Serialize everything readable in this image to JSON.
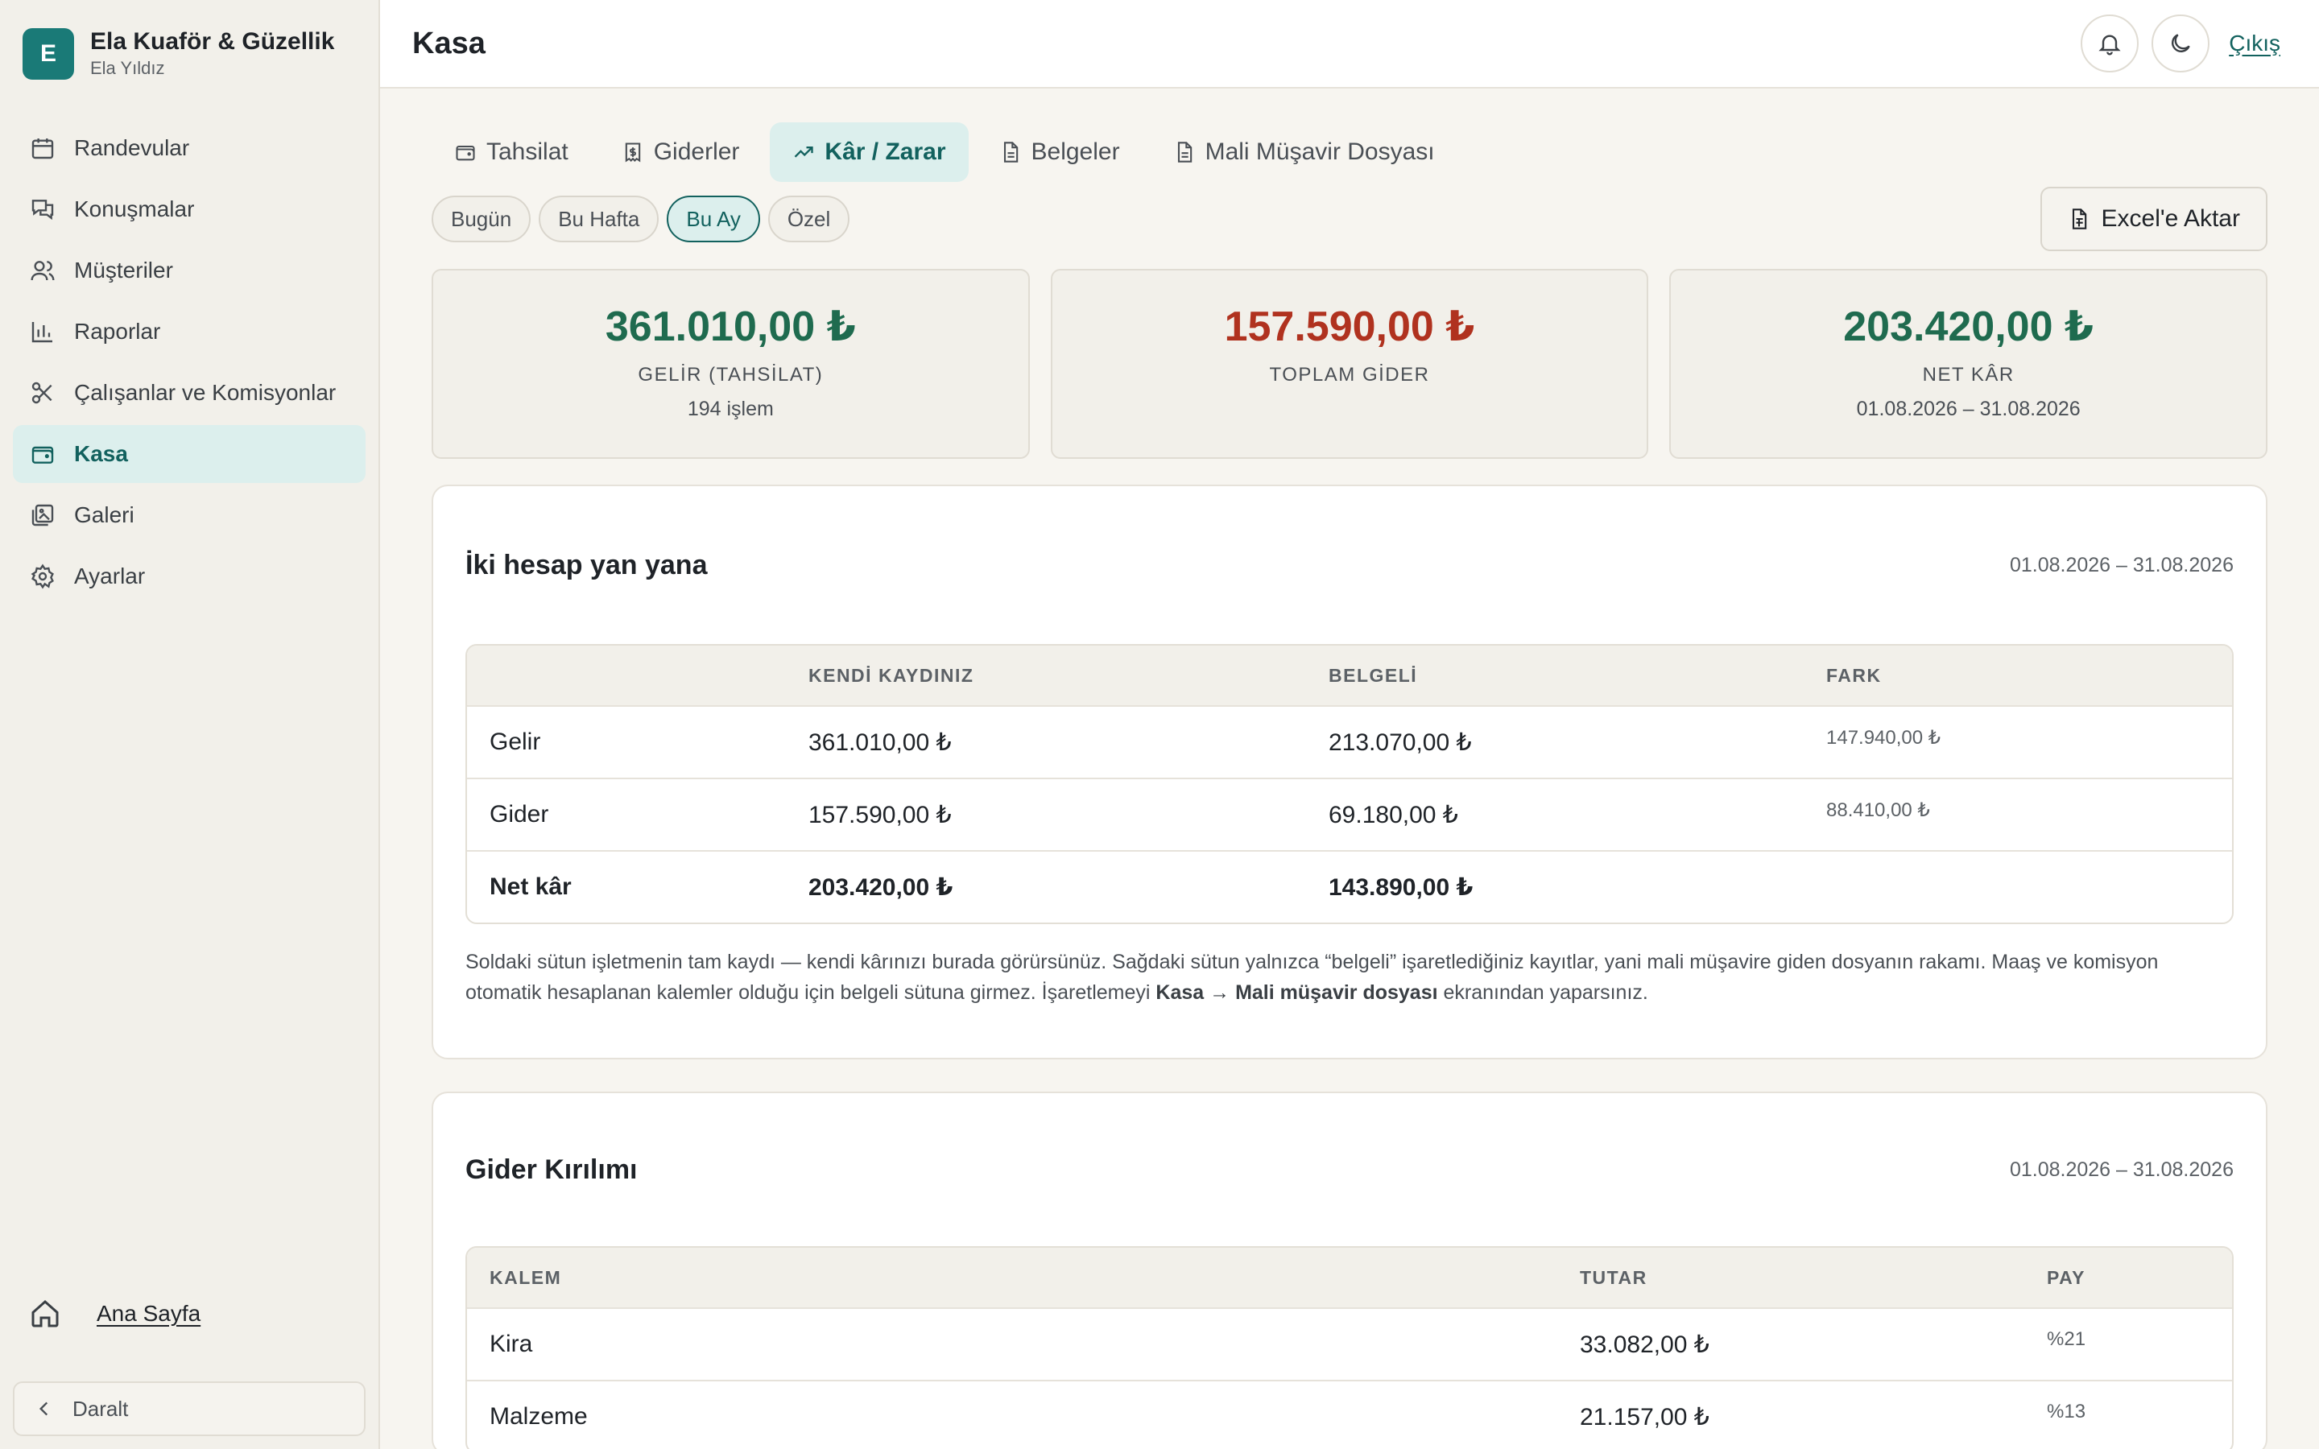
{
  "brand": {
    "initial": "E",
    "name": "Ela Kuaför & Güzellik",
    "user": "Ela Yıldız"
  },
  "nav": [
    {
      "label": "Randevular",
      "icon": "calendar-icon"
    },
    {
      "label": "Konuşmalar",
      "icon": "chat-icon"
    },
    {
      "label": "Müşteriler",
      "icon": "users-icon"
    },
    {
      "label": "Raporlar",
      "icon": "bar-chart-icon"
    },
    {
      "label": "Çalışanlar ve Komisyonlar",
      "icon": "scissors-icon"
    },
    {
      "label": "Kasa",
      "icon": "wallet-icon",
      "active": true
    },
    {
      "label": "Galeri",
      "icon": "gallery-icon"
    },
    {
      "label": "Ayarlar",
      "icon": "gear-icon"
    }
  ],
  "home_link": "Ana Sayfa",
  "collapse_label": "Daralt",
  "header": {
    "title": "Kasa",
    "logout": "Çıkış"
  },
  "tabs": [
    {
      "label": "Tahsilat",
      "icon": "wallet-icon"
    },
    {
      "label": "Giderler",
      "icon": "receipt-icon"
    },
    {
      "label": "Kâr / Zarar",
      "icon": "trend-up-icon",
      "active": true
    },
    {
      "label": "Belgeler",
      "icon": "document-icon"
    },
    {
      "label": "Mali Müşavir Dosyası",
      "icon": "document-icon"
    }
  ],
  "periods": [
    {
      "label": "Bugün"
    },
    {
      "label": "Bu Hafta"
    },
    {
      "label": "Bu Ay",
      "active": true
    },
    {
      "label": "Özel"
    }
  ],
  "export_label": "Excel'e Aktar",
  "stats": [
    {
      "value": "361.010,00 ₺",
      "label": "GELİR (TAHSİLAT)",
      "sub": "194 işlem",
      "color": "#1f6b4f"
    },
    {
      "value": "157.590,00 ₺",
      "label": "TOPLAM GİDER",
      "sub": "",
      "color": "#b0321f"
    },
    {
      "value": "203.420,00 ₺",
      "label": "NET KÂR",
      "sub": "01.08.2026 – 31.08.2026",
      "color": "#1f6b4f"
    }
  ],
  "comparison": {
    "title": "İki hesap yan yana",
    "range": "01.08.2026 – 31.08.2026",
    "columns": [
      "",
      "KENDİ KAYDINIZ",
      "BELGELİ",
      "FARK"
    ],
    "rows": [
      {
        "label": "Gelir",
        "own": "361.010,00 ₺",
        "doc": "213.070,00 ₺",
        "diff": "147.940,00 ₺"
      },
      {
        "label": "Gider",
        "own": "157.590,00 ₺",
        "doc": "69.180,00 ₺",
        "diff": "88.410,00 ₺"
      },
      {
        "label": "Net kâr",
        "own": "203.420,00 ₺",
        "doc": "143.890,00 ₺",
        "diff": ""
      }
    ],
    "note_part1": "Soldaki sütun işletmenin tam kaydı — kendi kârınızı burada görürsünüz. Sağdaki sütun yalnızca “belgeli” işaretlediğiniz kayıtlar, yani mali müşavire giden dosyanın rakamı. Maaş ve komisyon otomatik hesaplanan kalemler olduğu için belgeli sütuna girmez. İşaretlemeyi ",
    "note_bold": "Kasa → Mali müşavir dosyası",
    "note_part2": " ekranından yaparsınız."
  },
  "breakdown": {
    "title": "Gider Kırılımı",
    "range": "01.08.2026 – 31.08.2026",
    "columns": [
      "KALEM",
      "TUTAR",
      "PAY"
    ],
    "rows": [
      {
        "item": "Kira",
        "amount": "33.082,00 ₺",
        "share": "%21"
      },
      {
        "item": "Malzeme",
        "amount": "21.157,00 ₺",
        "share": "%13"
      }
    ]
  }
}
